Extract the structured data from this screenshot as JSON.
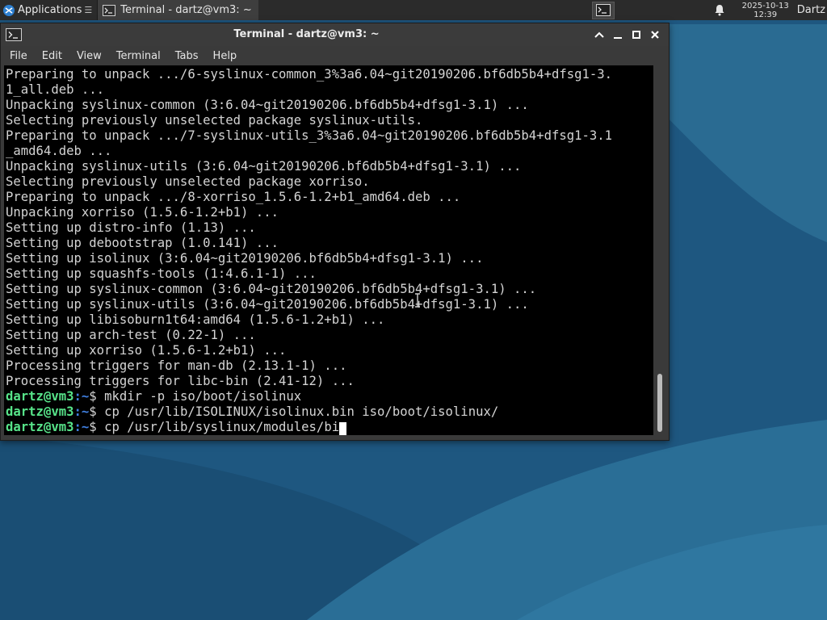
{
  "panel": {
    "apps_label": "Applications",
    "apps_sep_glyph": "☰",
    "task_label": "Terminal - dartz@vm3: ~",
    "clock_date": "2025-10-13",
    "clock_time": "12:39",
    "user_label": "Dartz"
  },
  "window": {
    "title": "Terminal - dartz@vm3: ~",
    "menu": [
      "File",
      "Edit",
      "View",
      "Terminal",
      "Tabs",
      "Help"
    ]
  },
  "terminal": {
    "output_lines": [
      "Preparing to unpack .../6-syslinux-common_3%3a6.04~git20190206.bf6db5b4+dfsg1-3.",
      "1_all.deb ...",
      "Unpacking syslinux-common (3:6.04~git20190206.bf6db5b4+dfsg1-3.1) ...",
      "Selecting previously unselected package syslinux-utils.",
      "Preparing to unpack .../7-syslinux-utils_3%3a6.04~git20190206.bf6db5b4+dfsg1-3.1",
      "_amd64.deb ...",
      "Unpacking syslinux-utils (3:6.04~git20190206.bf6db5b4+dfsg1-3.1) ...",
      "Selecting previously unselected package xorriso.",
      "Preparing to unpack .../8-xorriso_1.5.6-1.2+b1_amd64.deb ...",
      "Unpacking xorriso (1.5.6-1.2+b1) ...",
      "Setting up distro-info (1.13) ...",
      "Setting up debootstrap (1.0.141) ...",
      "Setting up isolinux (3:6.04~git20190206.bf6db5b4+dfsg1-3.1) ...",
      "Setting up squashfs-tools (1:4.6.1-1) ...",
      "Setting up syslinux-common (3:6.04~git20190206.bf6db5b4+dfsg1-3.1) ...",
      "Setting up syslinux-utils (3:6.04~git20190206.bf6db5b4+dfsg1-3.1) ...",
      "Setting up libisoburn1t64:amd64 (1.5.6-1.2+b1) ...",
      "Setting up arch-test (0.22-1) ...",
      "Setting up xorriso (1.5.6-1.2+b1) ...",
      "Processing triggers for man-db (2.13.1-1) ...",
      "Processing triggers for libc-bin (2.41-12) ..."
    ],
    "prompt_user": "dartz@vm3",
    "prompt_path": ":~",
    "prompt_symbol": "$ ",
    "commands": [
      "mkdir -p iso/boot/isolinux",
      "cp /usr/lib/ISOLINUX/isolinux.bin iso/boot/isolinux/",
      "cp /usr/lib/syslinux/modules/bi"
    ]
  },
  "colors": {
    "prompt_user": "#57e389",
    "prompt_path": "#3f7fe0",
    "terminal_bg": "#000000",
    "terminal_fg": "#d4d4d4"
  }
}
